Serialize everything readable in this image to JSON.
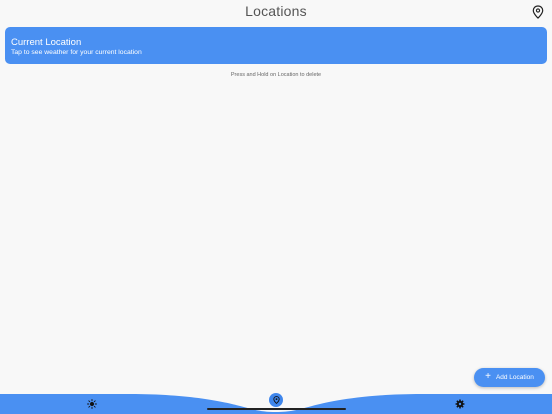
{
  "header": {
    "title": "Locations",
    "pin_icon": "map-pin-icon"
  },
  "current_location": {
    "title": "Current Location",
    "subtitle": "Tap to see weather for your current location"
  },
  "hint": "Press and Hold on Location to delete",
  "fab": {
    "label": "Add Location",
    "icon": "plus-icon"
  },
  "bottom_nav": {
    "items": [
      {
        "icon": "sun-icon",
        "active": false
      },
      {
        "icon": "map-pin-icon",
        "active": true
      },
      {
        "icon": "gear-icon",
        "active": false
      }
    ]
  },
  "colors": {
    "accent": "#4a90f2",
    "background": "#f8f8f8"
  }
}
